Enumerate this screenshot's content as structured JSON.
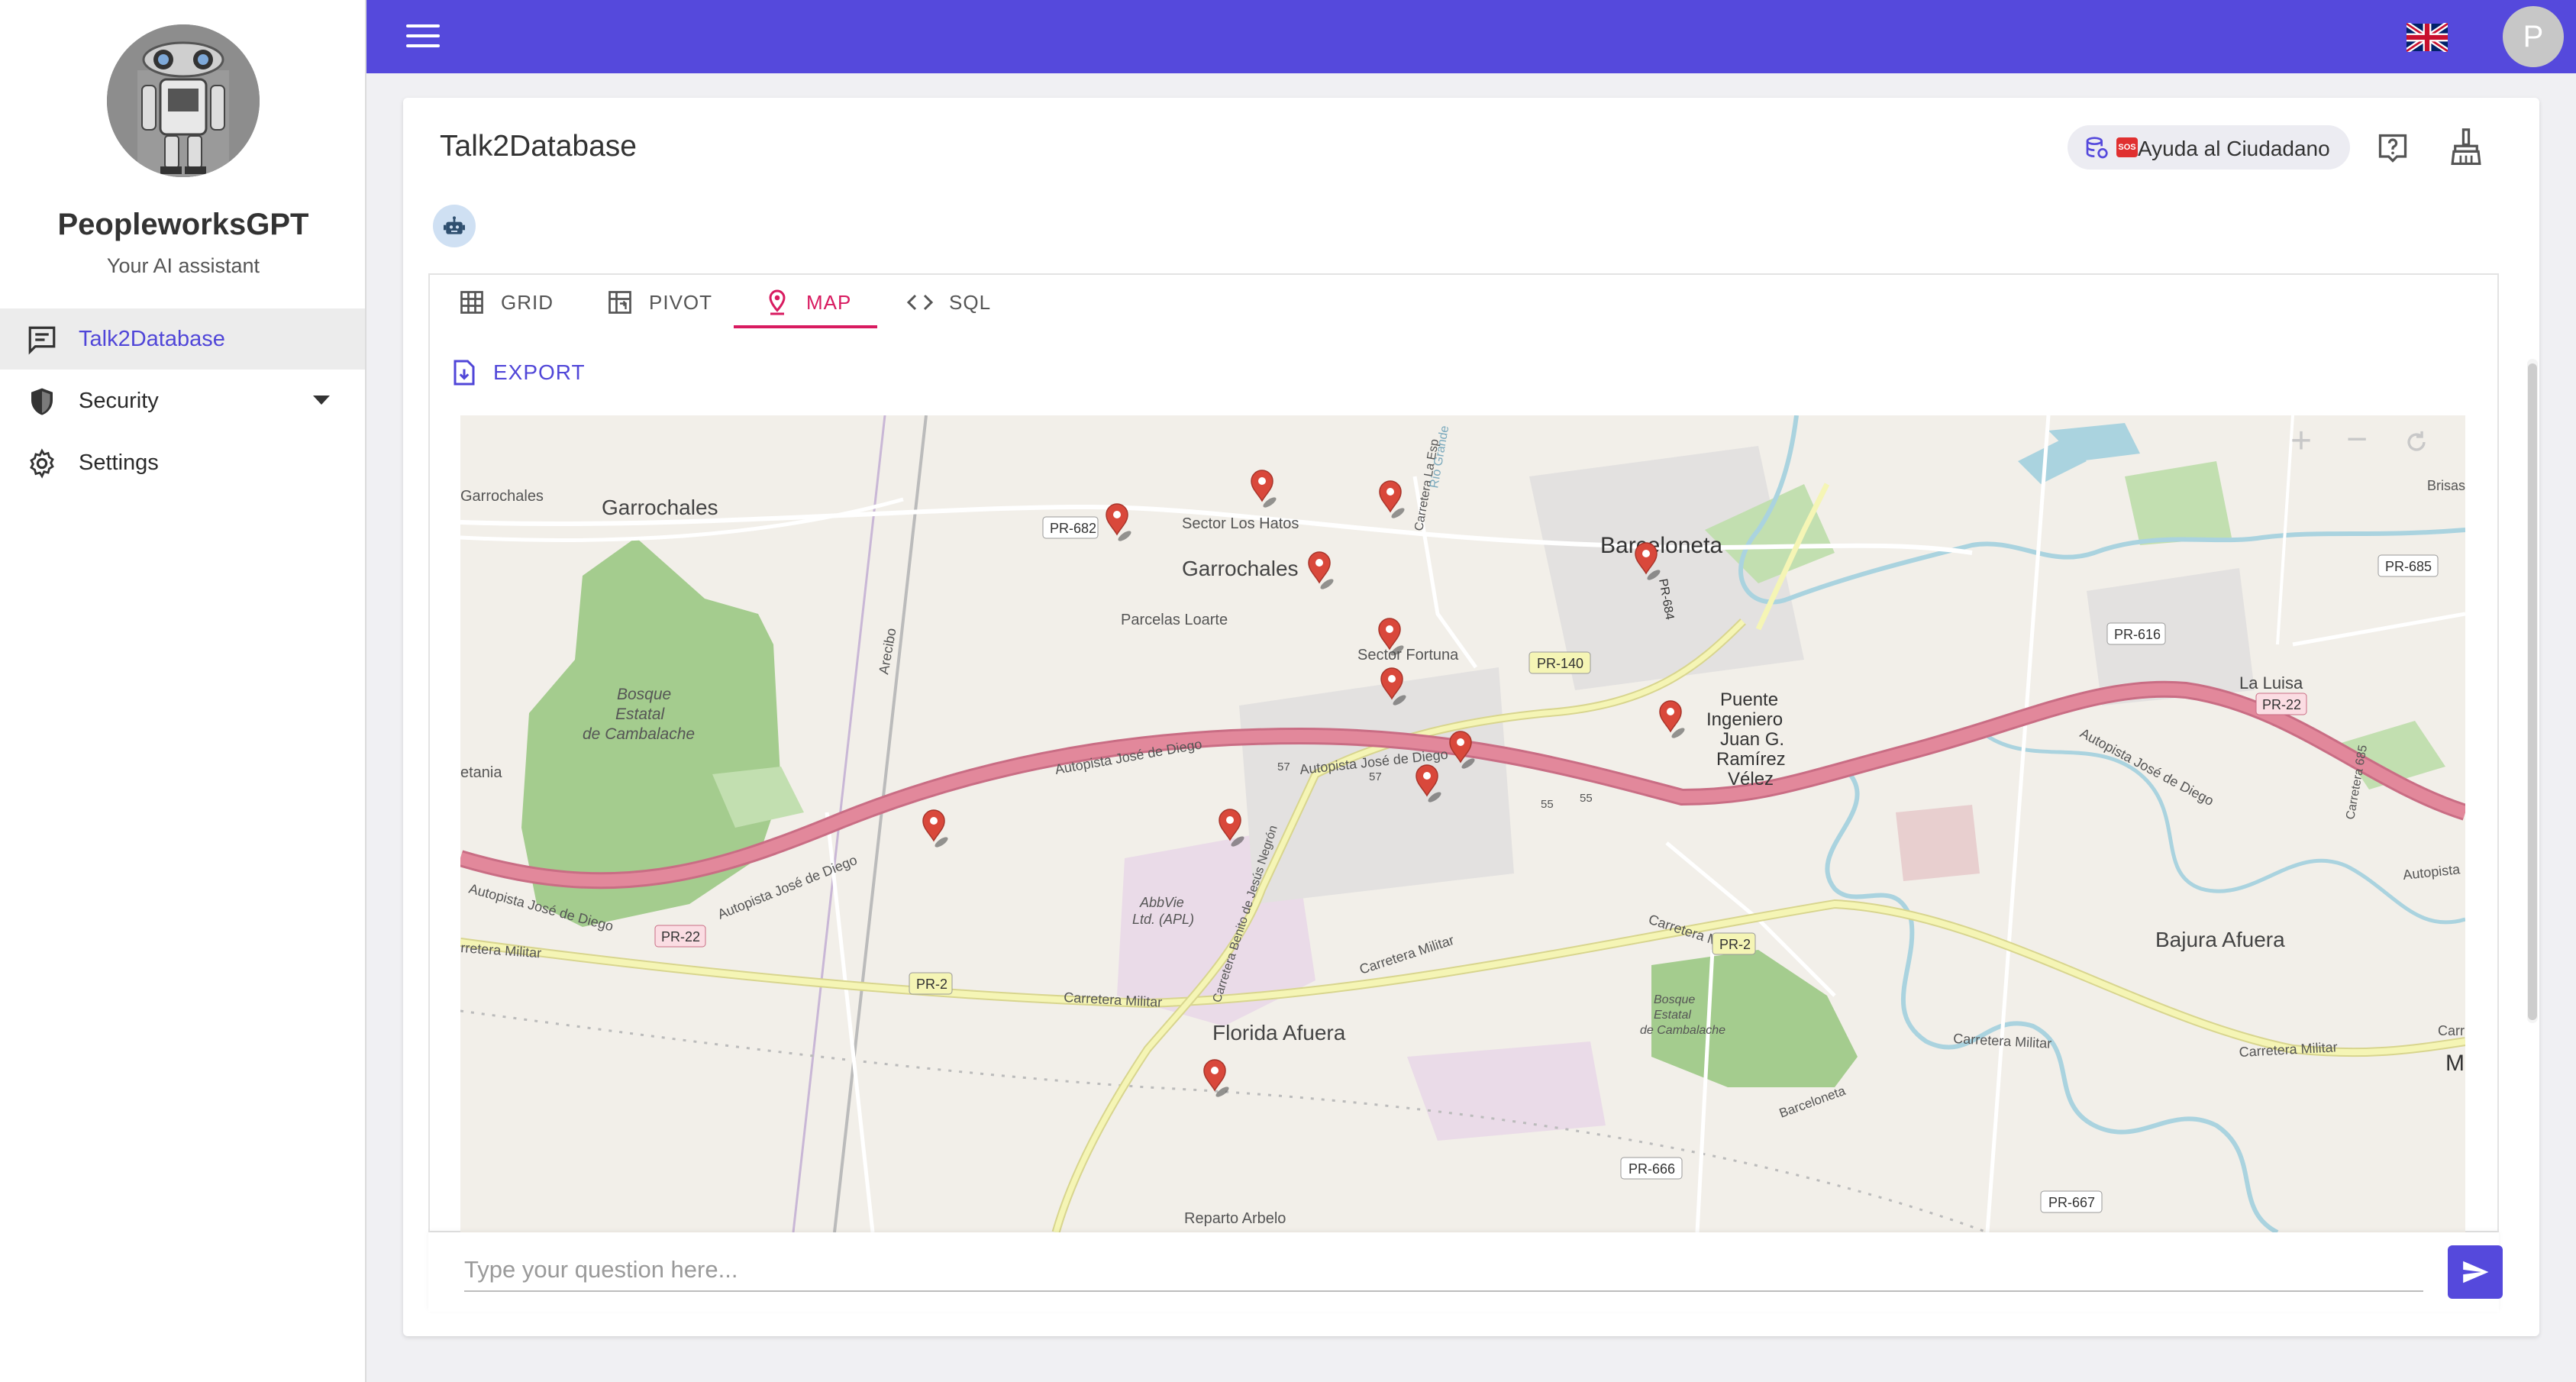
{
  "app": {
    "name": "PeopleworksGPT",
    "subtitle": "Your AI assistant"
  },
  "sidebar": {
    "items": [
      {
        "label": "Talk2Database",
        "icon": "chat-icon",
        "active": true
      },
      {
        "label": "Security",
        "icon": "shield-icon",
        "expandable": true
      },
      {
        "label": "Settings",
        "icon": "gear-icon"
      }
    ]
  },
  "topbar": {
    "menu_icon": "hamburger-icon",
    "language_flag": "uk-flag-icon",
    "user_initial": "P"
  },
  "page": {
    "title": "Talk2Database",
    "datasource_chip": "Ayuda al Ciudadano",
    "datasource_badge": "SOS",
    "help_icon": "help-icon",
    "clear_icon": "broom-icon"
  },
  "tabs": [
    {
      "label": "GRID",
      "icon": "grid-icon"
    },
    {
      "label": "PIVOT",
      "icon": "pivot-icon"
    },
    {
      "label": "MAP",
      "icon": "map-pin-icon",
      "active": true
    },
    {
      "label": "SQL",
      "icon": "code-icon"
    }
  ],
  "export": {
    "label": "EXPORT"
  },
  "map": {
    "labels": {
      "garrochales_left": "Garrochales",
      "garrochales_town": "Garrochales",
      "garrochales_main": "Garrochales",
      "sector_los_hatos": "Sector Los Hatos",
      "parcelas_loarte": "Parcelas Loarte",
      "sector_fortuna": "Sector Fortuna",
      "barceloneta": "Barceloneta",
      "bosque_1": "Bosque",
      "bosque_2": "Estatal",
      "bosque_3": "de Cambalache",
      "bosque_small_1": "Bosque",
      "bosque_small_2": "Estatal",
      "bosque_small_3": "de Cambalache",
      "puente_1": "Puente",
      "puente_2": "Ingeniero",
      "puente_3": "Juan G.",
      "puente_4": "Ramírez",
      "puente_5": "Vélez",
      "la_luisa": "La Luisa",
      "bajura_afuera": "Bajura Afuera",
      "florida_afuera": "Florida Afuera",
      "abbvie_1": "AbbVie",
      "abbvie_2": "Ltd. (APL)",
      "reparto_arbelo": "Reparto Arbelo",
      "betania": "etania",
      "brisas": "Brisas",
      "m_edge": "M",
      "arecibo": "Arecibo",
      "autopista_1": "Autopista José de Diego",
      "autopista_2": "Autopista José de Diego",
      "autopista_3": "Autopista José de Diego",
      "autopista_4": "Autopista José de Diego",
      "autopista_5": "Autopista José de Diego",
      "autopista_edge": "Autopista",
      "carretera_militar_1": "rretera Militar",
      "carretera_militar_2": "Carretera Militar",
      "carretera_militar_3": "Carretera Militar",
      "carretera_militar_4": "Carretera Militar",
      "carretera_militar_5": "Carretera Militar",
      "carretera_militar_6": "Carretera Militar",
      "carretera_militar_edge": "Carr",
      "carretera_benito": "Carretera Benito de Jesús Negrón",
      "carretera_la_esp": "Carretera La Esp",
      "carretera_685": "Carretera 685",
      "barceloneta_road": "Barceloneta",
      "rio": "Río Grande",
      "pr_682": "PR-682",
      "pr_140": "PR-140",
      "pr_684": "PR-684",
      "pr_22_a": "PR-22",
      "pr_22_b": "PR-22",
      "pr_2_a": "PR-2",
      "pr_2_b": "PR-2",
      "pr_616": "PR-616",
      "pr_685": "PR-685",
      "pr_666": "PR-666",
      "pr_667": "PR-667",
      "n57a": "57",
      "n57b": "57",
      "n55a": "55",
      "n55b": "55"
    },
    "markers": 13,
    "marker_color": "#d9483b",
    "zoom_in": "+",
    "zoom_out": "−"
  },
  "input": {
    "placeholder": "Type your question here..."
  },
  "colors": {
    "primary": "#5549dc",
    "accent_tab": "#d81b60",
    "highway": "#e2889b",
    "secondary_road": "#f3f3a8",
    "forest": "#a4cc8e"
  }
}
